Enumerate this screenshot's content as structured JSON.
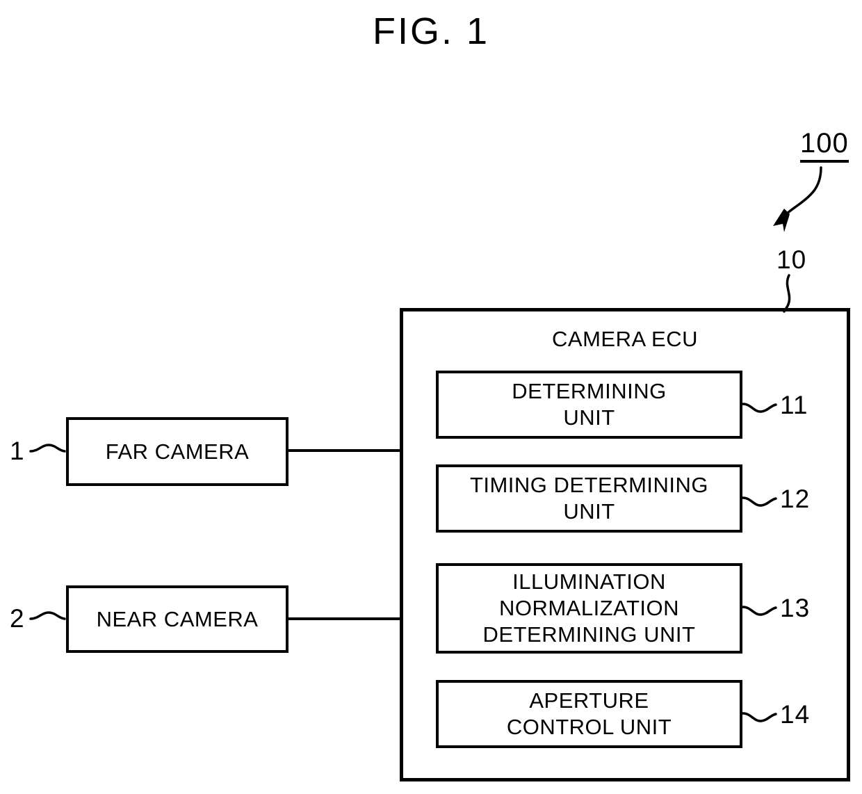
{
  "figure": {
    "title": "FIG. 1",
    "system_numeral": "100"
  },
  "ecu": {
    "title": "CAMERA ECU",
    "numeral": "10",
    "units": [
      {
        "label": "DETERMINING\nUNIT",
        "numeral": "11"
      },
      {
        "label": "TIMING DETERMINING\nUNIT",
        "numeral": "12"
      },
      {
        "label": "ILLUMINATION\nNORMALIZATION\nDETERMINING UNIT",
        "numeral": "13"
      },
      {
        "label": "APERTURE\nCONTROL UNIT",
        "numeral": "14"
      }
    ]
  },
  "cameras": [
    {
      "label": "FAR CAMERA",
      "numeral": "1"
    },
    {
      "label": "NEAR CAMERA",
      "numeral": "2"
    }
  ],
  "style": {
    "line_color": "#000000",
    "background": "#ffffff"
  }
}
